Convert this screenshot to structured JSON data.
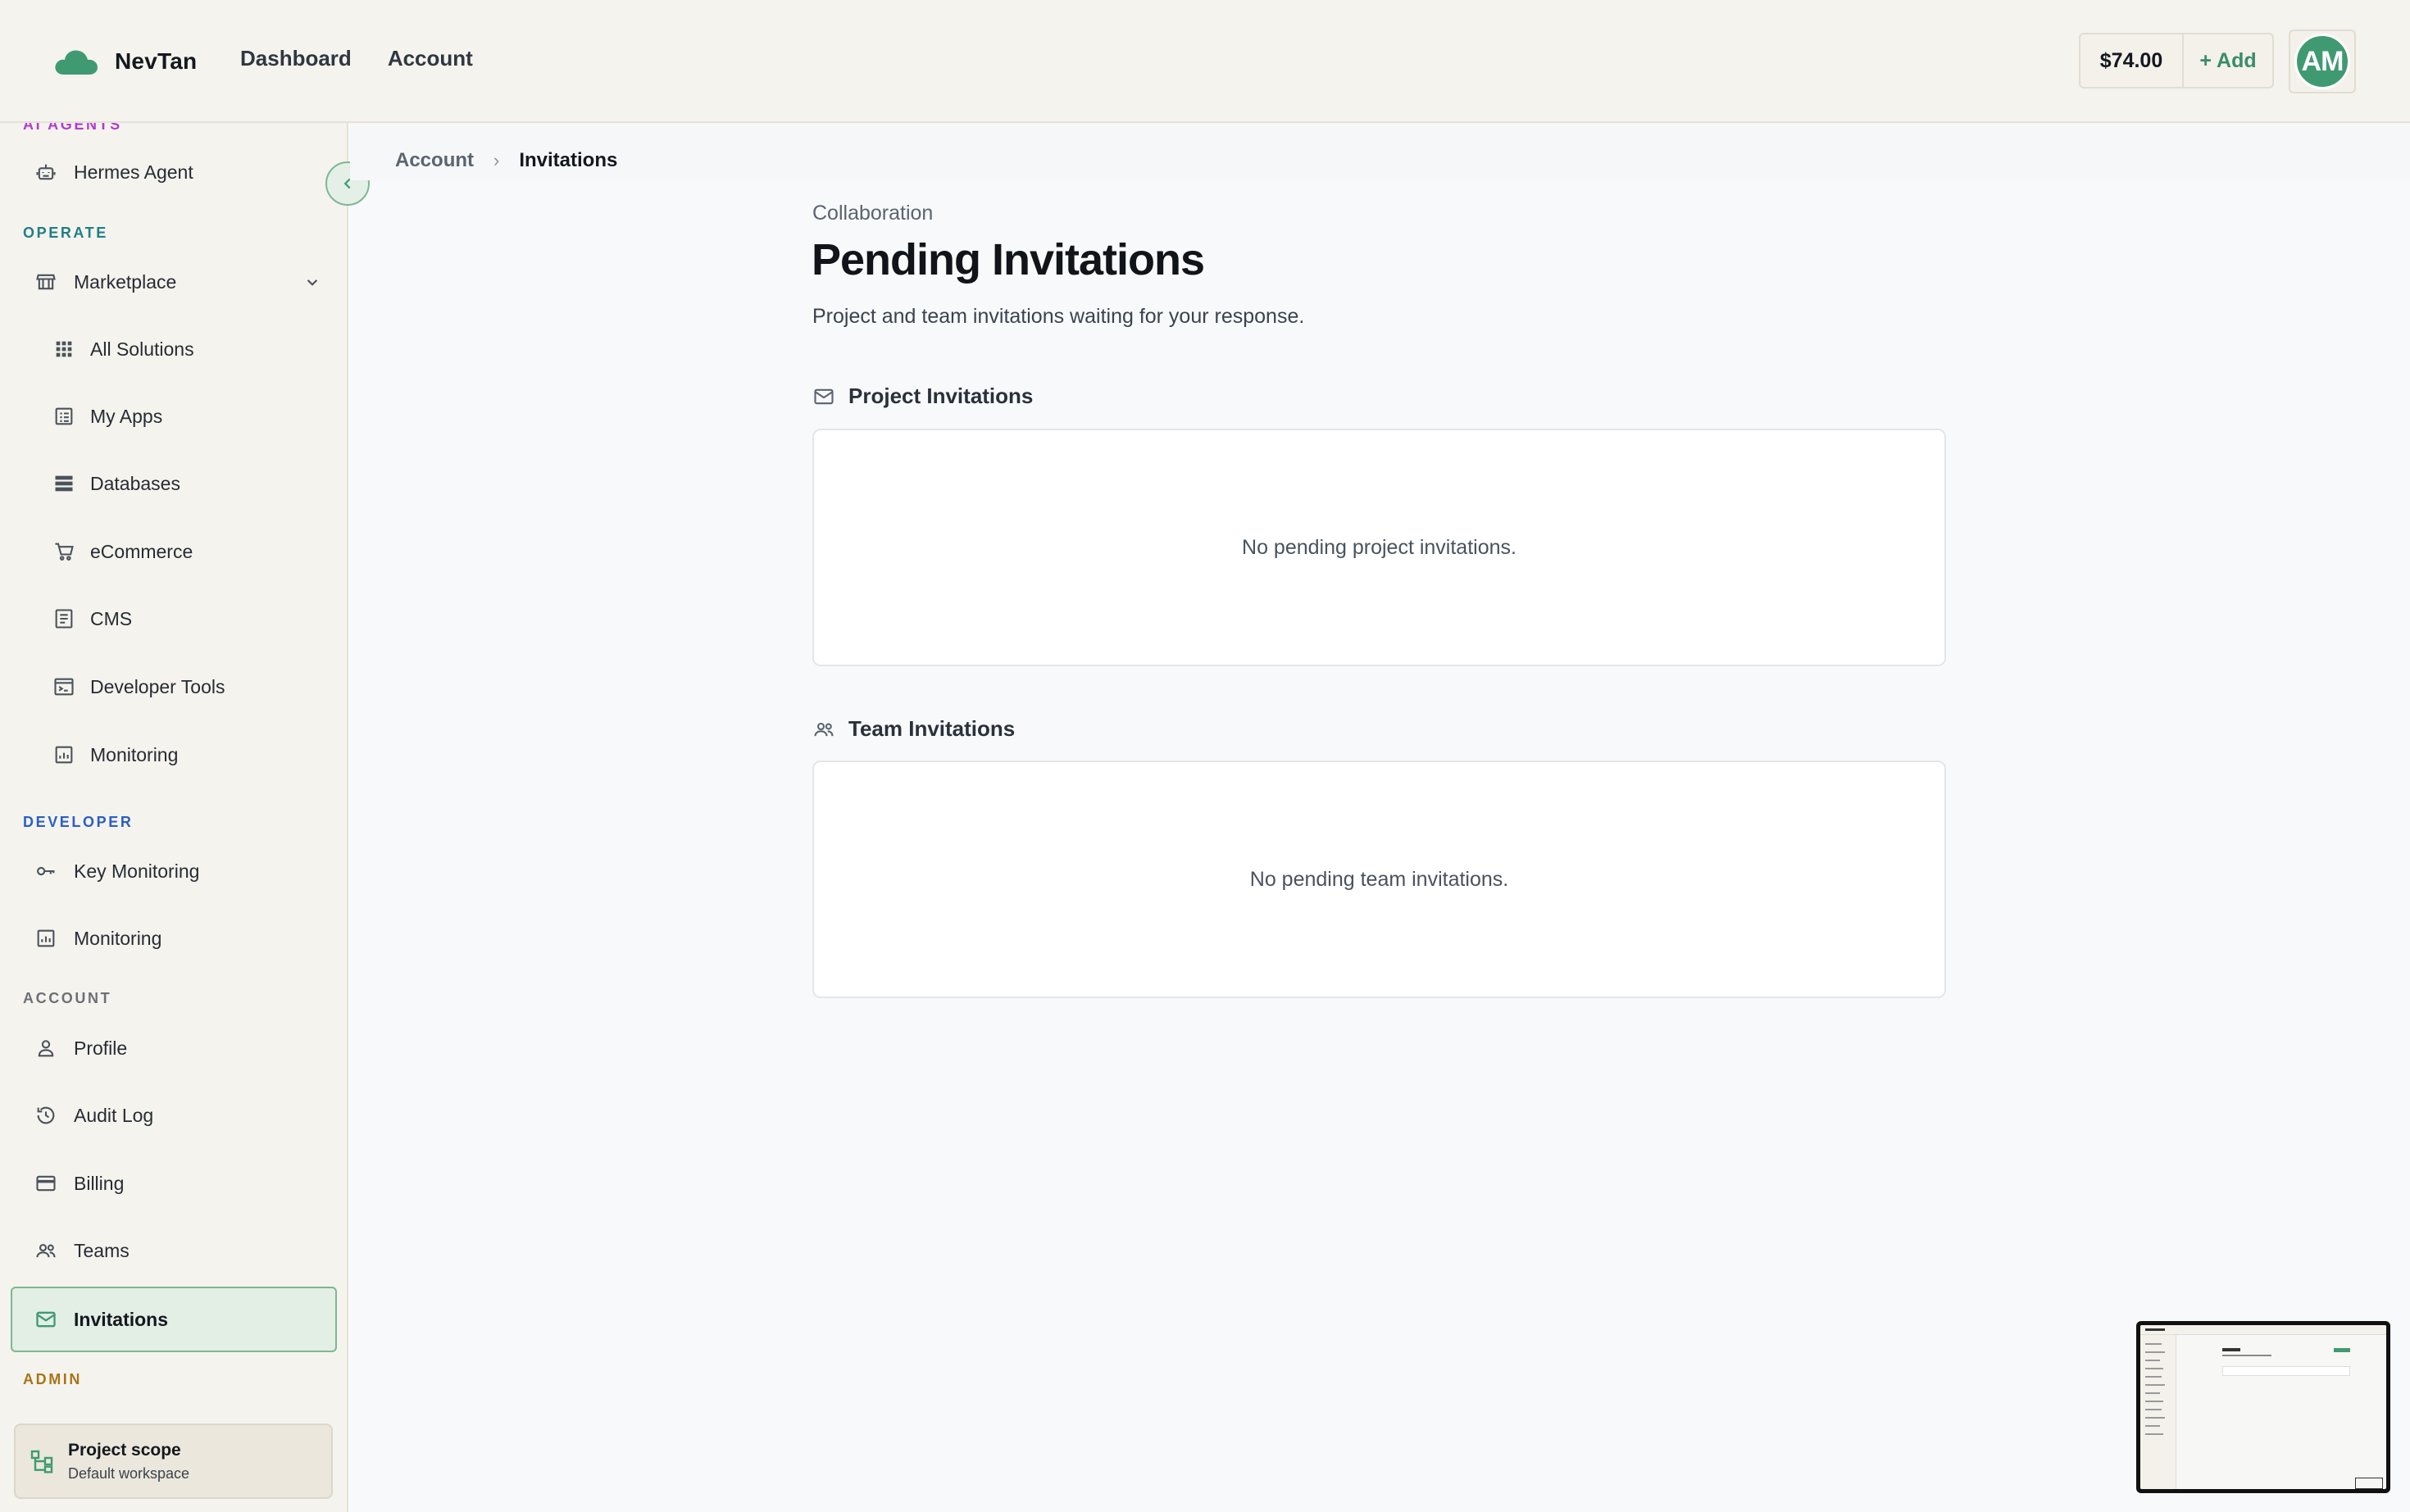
{
  "header": {
    "brand": "NevTan",
    "nav": [
      "Dashboard",
      "Account"
    ],
    "balance": "$74.00",
    "add_label": "+ Add",
    "avatar_initials": "AM"
  },
  "sidebar": {
    "partial_label": "AI AGENTS",
    "hermes": "Hermes Agent",
    "operate_label": "OPERATE",
    "marketplace": "Marketplace",
    "all_solutions": "All Solutions",
    "my_apps": "My Apps",
    "databases": "Databases",
    "ecommerce": "eCommerce",
    "cms": "CMS",
    "developer_tools": "Developer Tools",
    "monitoring_sub": "Monitoring",
    "developer_label": "DEVELOPER",
    "key_monitoring": "Key Monitoring",
    "monitoring": "Monitoring",
    "account_label": "ACCOUNT",
    "profile": "Profile",
    "audit_log": "Audit Log",
    "billing": "Billing",
    "teams": "Teams",
    "invitations": "Invitations",
    "admin_label": "ADMIN",
    "scope_title": "Project scope",
    "scope_sub": "Default workspace"
  },
  "breadcrumb": {
    "parent": "Account",
    "current": "Invitations"
  },
  "page": {
    "eyebrow": "Collaboration",
    "title": "Pending Invitations",
    "subtitle": "Project and team invitations waiting for your response.",
    "project_heading": "Project Invitations",
    "project_empty": "No pending project invitations.",
    "team_heading": "Team Invitations",
    "team_empty": "No pending team invitations."
  },
  "colors": {
    "accent": "#3f9a72",
    "ai_agents": "#b43bd1",
    "operate": "#1f7f86",
    "developer": "#2b5fc2",
    "account": "#6b7078",
    "admin": "#a8741a"
  }
}
